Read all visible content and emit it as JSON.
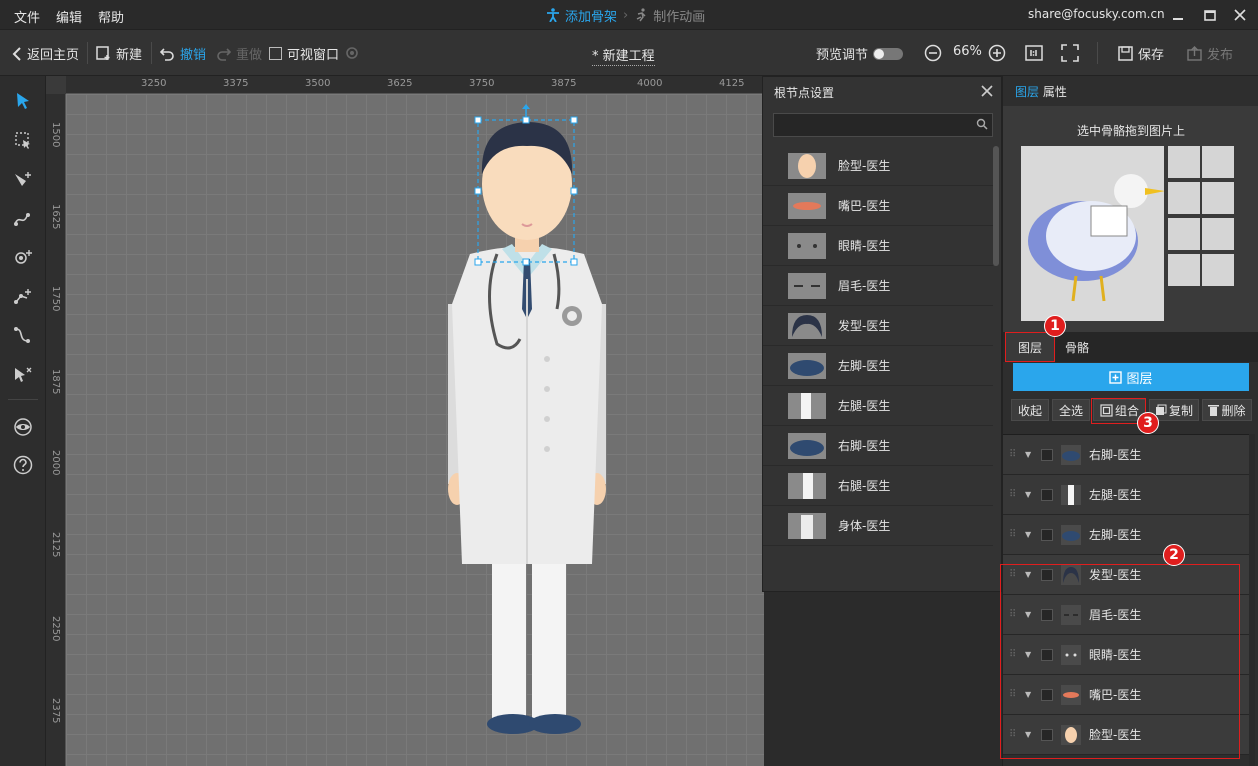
{
  "menubar": {
    "items": [
      "文件",
      "编辑",
      "帮助"
    ],
    "step_active": "添加骨架",
    "step_inactive": "制作动画",
    "email": "share@focusky.com.cn"
  },
  "toolbar": {
    "back": "返回主页",
    "new": "新建",
    "undo": "撤销",
    "redo": "重做",
    "visible_window": "可视窗口",
    "project_title": "* 新建工程",
    "preview_adjust": "预览调节",
    "zoom": "66%",
    "save": "保存",
    "publish": "发布"
  },
  "ruler": {
    "h": [
      "3250",
      "3375",
      "3500",
      "3625",
      "3750",
      "3875",
      "4000",
      "4125"
    ],
    "v": [
      "1500",
      "1625",
      "1750",
      "1875",
      "2000",
      "2125",
      "2250",
      "2375"
    ]
  },
  "node_panel": {
    "title": "根节点设置",
    "items": [
      {
        "label": "脸型-医生",
        "icon": "face-thumb"
      },
      {
        "label": "嘴巴-医生",
        "icon": "mouth-thumb"
      },
      {
        "label": "眼睛-医生",
        "icon": "eyes-thumb"
      },
      {
        "label": "眉毛-医生",
        "icon": "eyebrow-thumb"
      },
      {
        "label": "发型-医生",
        "icon": "hair-thumb"
      },
      {
        "label": "左脚-医生",
        "icon": "shoe-thumb"
      },
      {
        "label": "左腿-医生",
        "icon": "leg-thumb"
      },
      {
        "label": "右脚-医生",
        "icon": "shoe-thumb"
      },
      {
        "label": "右腿-医生",
        "icon": "leg-thumb"
      },
      {
        "label": "身体-医生",
        "icon": "body-thumb"
      }
    ]
  },
  "right_panel": {
    "tab_layers": "图层",
    "tab_props": "属性",
    "preview_caption": "选中骨骼拖到图片上",
    "subtab_layers": "图层",
    "subtab_bones": "骨骼",
    "add_layer": "图层",
    "actions": [
      "收起",
      "全选",
      "组合",
      "复制",
      "删除"
    ],
    "layers": [
      {
        "label": "右脚-医生"
      },
      {
        "label": "左腿-医生"
      },
      {
        "label": "左脚-医生"
      },
      {
        "label": "发型-医生"
      },
      {
        "label": "眉毛-医生"
      },
      {
        "label": "眼睛-医生"
      },
      {
        "label": "嘴巴-医生"
      },
      {
        "label": "脸型-医生"
      }
    ]
  },
  "annotations": {
    "badge1": "1",
    "badge2": "2",
    "badge3": "3"
  },
  "colors": {
    "accent": "#2aa6ec",
    "annotation_red": "#e01e1e"
  }
}
